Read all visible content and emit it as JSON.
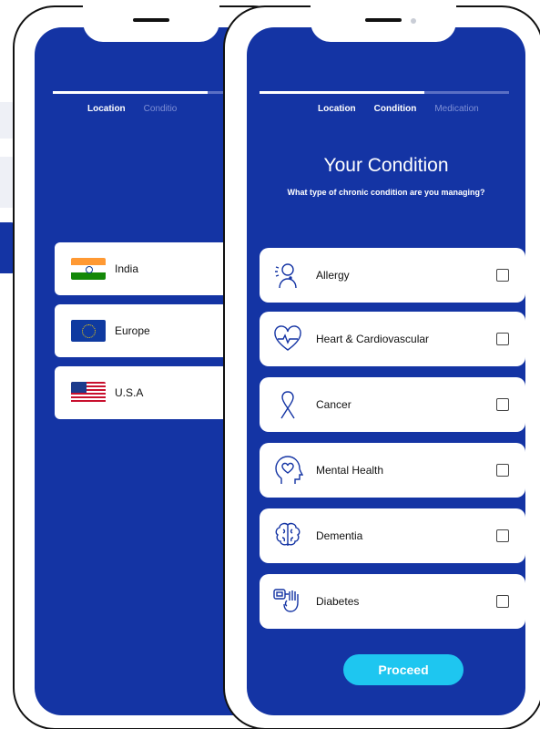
{
  "back_screen": {
    "steps": [
      {
        "label": "Location",
        "active": true
      },
      {
        "label": "Conditio",
        "active": false
      }
    ],
    "locations": [
      {
        "label": "India",
        "flag": "india-flag-icon"
      },
      {
        "label": "Europe",
        "flag": "europe-flag-icon"
      },
      {
        "label": "U.S.A",
        "flag": "usa-flag-icon"
      }
    ]
  },
  "front_screen": {
    "steps": [
      {
        "label": "Location",
        "active": true
      },
      {
        "label": "Condition",
        "active": true
      },
      {
        "label": "Medication",
        "active": false
      }
    ],
    "progress_fraction": 0.66,
    "title": "Your Condition",
    "subtitle": "What type of chronic condition are you managing?",
    "conditions": [
      {
        "label": "Allergy",
        "icon": "allergy-icon",
        "checked": false
      },
      {
        "label": "Heart & Cardiovascular",
        "icon": "heart-icon",
        "checked": false
      },
      {
        "label": "Cancer",
        "icon": "ribbon-icon",
        "checked": false
      },
      {
        "label": "Mental Health",
        "icon": "mental-health-icon",
        "checked": false
      },
      {
        "label": "Dementia",
        "icon": "brain-icon",
        "checked": false
      },
      {
        "label": "Diabetes",
        "icon": "glucose-meter-icon",
        "checked": false
      }
    ],
    "proceed_label": "Proceed"
  },
  "colors": {
    "screen_bg": "#1434a4",
    "card_bg": "#ffffff",
    "button_bg": "#1ec6f0",
    "inactive_step": "#7f90d6"
  }
}
